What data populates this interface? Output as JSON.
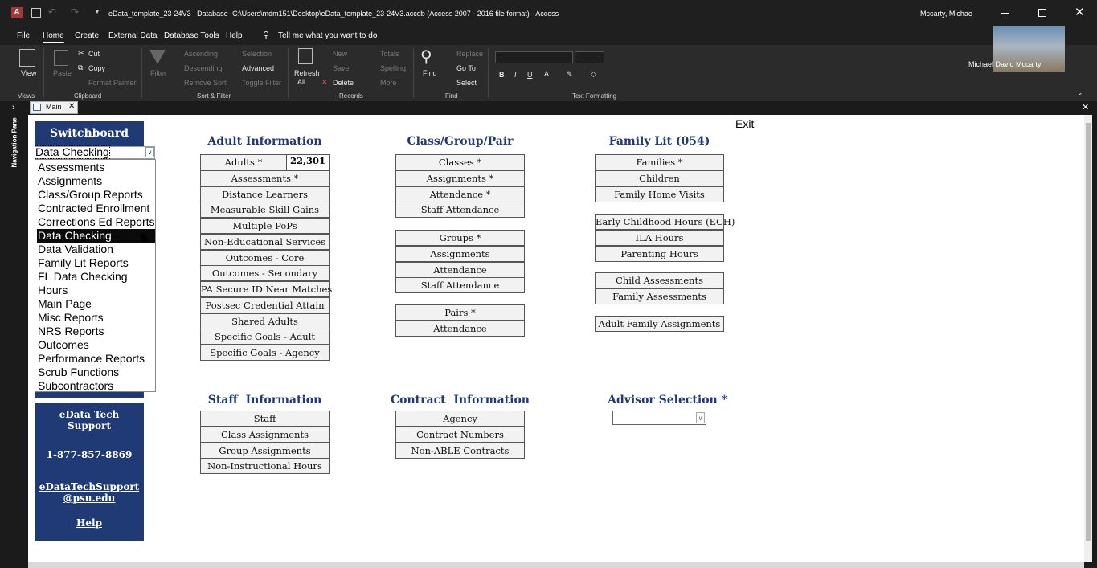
{
  "titlebar": {
    "title": "eData_template_23-24V3 : Database- C:\\Users\\mdm151\\Desktop\\eData_template_23-24V3.accdb (Access 2007 - 2016 file format)  -  Access",
    "user": "Mccarty, Michae",
    "participant": "Michael David Mccarty"
  },
  "menu": {
    "file": "File",
    "home": "Home",
    "create": "Create",
    "external": "External Data",
    "dbtools": "Database Tools",
    "help": "Help",
    "tellme": "Tell me what you want to do"
  },
  "ribbon": {
    "view": "View",
    "paste": "Paste",
    "cut": "Cut",
    "copy": "Copy",
    "format_painter": "Format Painter",
    "filter": "Filter",
    "ascending": "Ascending",
    "descending": "Descending",
    "remove_sort": "Remove Sort",
    "selection": "Selection",
    "advanced": "Advanced",
    "toggle_filter": "Toggle Filter",
    "refresh": "Refresh",
    "refresh_all": "All",
    "new": "New",
    "save": "Save",
    "delete": "Delete",
    "totals": "Totals",
    "spelling": "Spelling",
    "more": "More",
    "find": "Find",
    "replace": "Replace",
    "goto": "Go To",
    "select": "Select",
    "groups": {
      "views": "Views",
      "clipboard": "Clipboard",
      "sortfilter": "Sort & Filter",
      "records": "Records",
      "find": "Find",
      "textformat": "Text Formatting"
    }
  },
  "tab": {
    "label": "Main"
  },
  "navpane": {
    "label": "Navigation Pane"
  },
  "form": {
    "exit": "Exit",
    "switchboard": {
      "title": "Switchboard",
      "selected": "Data Checking",
      "options": [
        "Assessments",
        "Assignments",
        "Class/Group Reports",
        "Contracted Enrollment",
        "Corrections Ed Reports",
        "Data Checking",
        "Data Validation",
        "Family Lit Reports",
        "FL Data Checking",
        "Hours",
        "Main Page",
        "Misc Reports",
        "NRS Reports",
        "Outcomes",
        "Performance Reports",
        "Scrub Functions",
        "Subcontractors"
      ],
      "highlighted": "Data Checking"
    },
    "support": {
      "title1": "eData Tech",
      "title2": "Support",
      "phone": "1-877-857-8869",
      "email1": "eDataTechSupport",
      "email2": "@psu.edu",
      "help": "Help"
    },
    "adult": {
      "title": "Adult Information",
      "count": "22,301",
      "buttons": [
        "Adults *",
        "Assessments *",
        "Distance Learners",
        "Measurable Skill Gains",
        "Multiple PoPs",
        "Non-Educational Services",
        "Outcomes - Core",
        "Outcomes - Secondary",
        "PA Secure ID Near Matches",
        "Postsec Credential Attain",
        "Shared Adults",
        "Specific Goals - Adult",
        "Specific Goals - Agency"
      ]
    },
    "class": {
      "title": "Class/Group/Pair",
      "classes": [
        "Classes *",
        "Assignments *",
        "Attendance *",
        "Staff Attendance"
      ],
      "groups": [
        "Groups *",
        "Assignments",
        "Attendance",
        "Staff Attendance"
      ],
      "pairs": [
        "Pairs *",
        "Attendance"
      ]
    },
    "family": {
      "title": "Family Lit (054)",
      "g1": [
        "Families *",
        "Children",
        "Family Home Visits"
      ],
      "g2": [
        "Early Childhood Hours (ECH)",
        "ILA Hours",
        "Parenting Hours"
      ],
      "g3": [
        "Child Assessments",
        "Family Assessments"
      ],
      "g4": [
        "Adult Family Assignments"
      ]
    },
    "staff": {
      "title": "Staff  Information",
      "buttons": [
        "Staff",
        "Class Assignments",
        "Group Assignments",
        "Non-Instructional Hours"
      ]
    },
    "contract": {
      "title": "Contract  Information",
      "buttons": [
        "Agency",
        "Contract Numbers",
        "Non-ABLE Contracts"
      ]
    },
    "advisor": {
      "title": "Advisor Selection *",
      "value": ""
    }
  }
}
